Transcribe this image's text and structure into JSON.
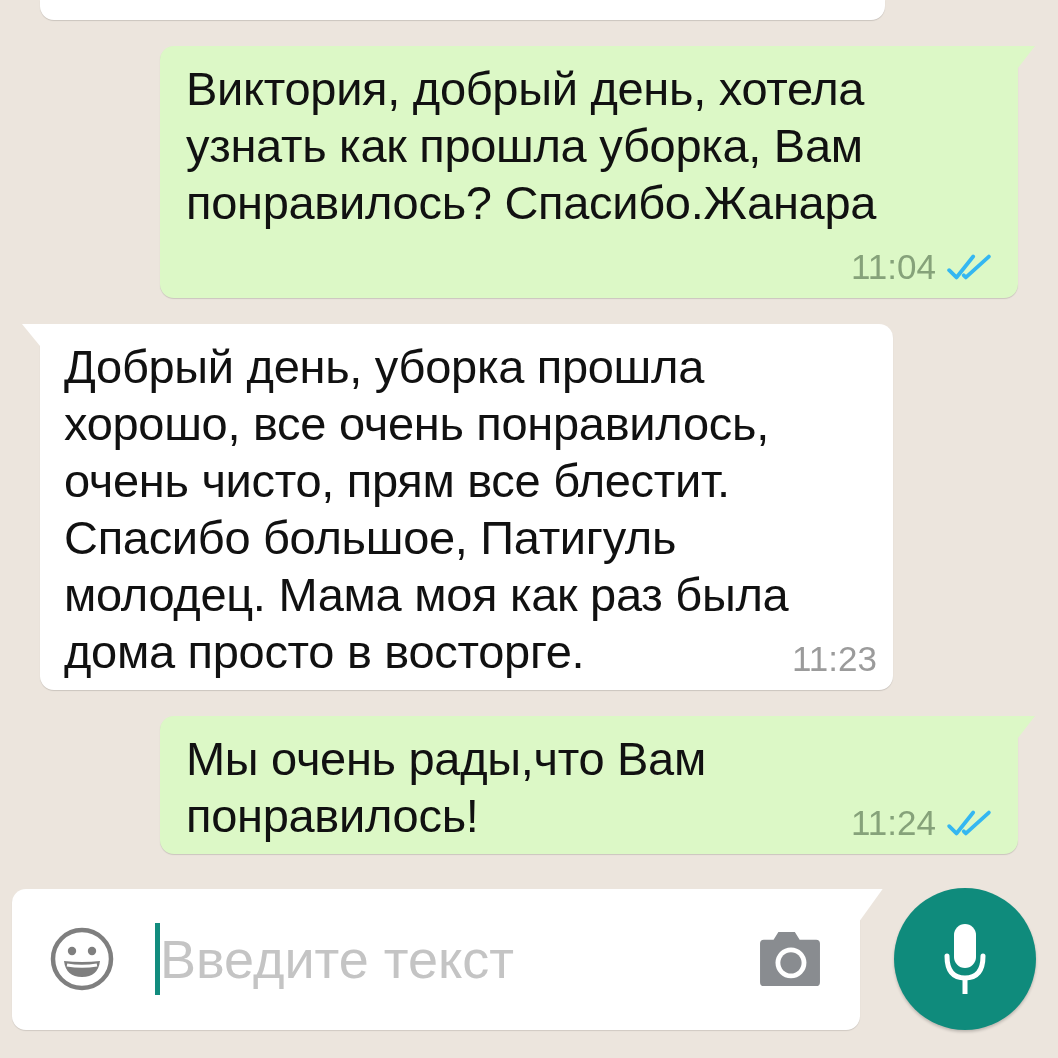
{
  "messages": [
    {
      "kind": "incoming",
      "cut_off": true
    },
    {
      "kind": "outgoing",
      "lines": [
        "Виктория, добрый день, хотела",
        "узнать как прошла уборка, Вам",
        "понравилось? Спасибо.Жанара"
      ],
      "time": "11:04",
      "read": true
    },
    {
      "kind": "incoming",
      "lines": [
        "Добрый день, уборка прошла",
        "хорошо, все очень понравилось,",
        "очень чисто, прям все блестит.",
        "Спасибо большое, Патигуль",
        "молодец. Мама моя как раз была",
        "дома просто в восторге."
      ],
      "time": "11:23"
    },
    {
      "kind": "outgoing",
      "lines": [
        "Мы очень рады,что Вам",
        "понравилось!"
      ],
      "time": "11:24",
      "read": true
    }
  ],
  "composer": {
    "placeholder": "Введите текст"
  }
}
